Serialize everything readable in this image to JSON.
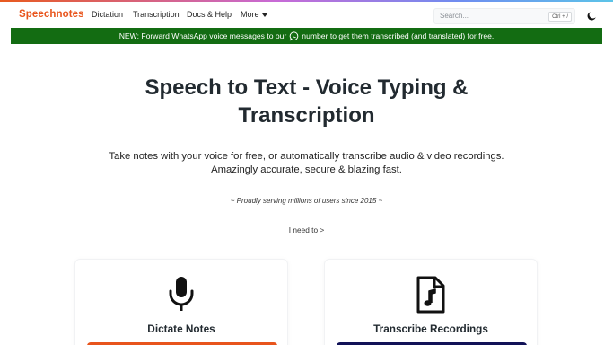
{
  "nav": {
    "brand": "Speechnotes",
    "links": [
      "Dictation",
      "Transcription",
      "Docs & Help",
      "More"
    ],
    "search_placeholder": "Search...",
    "search_shortcut": "Ctrl + /",
    "theme_icon": "moon-icon"
  },
  "banner": {
    "text_before": "NEW: Forward WhatsApp voice messages to our",
    "icon": "whatsapp-icon",
    "text_after": "number to get them transcribed (and translated) for free."
  },
  "hero": {
    "title_line1": "Speech to Text - Voice Typing &",
    "title_line2": "Transcription",
    "subtitle_line1": "Take notes with your voice for free, or automatically transcribe audio & video recordings.",
    "subtitle_line2": "Amazingly accurate, secure & blazing fast.",
    "serving": "~ Proudly serving millions of users since 2015 ~",
    "prompt": "I need to >"
  },
  "cards": [
    {
      "title": "Dictate Notes",
      "icon": "microphone-icon",
      "button_color": "#e8541c"
    },
    {
      "title": "Transcribe Recordings",
      "icon": "audio-file-icon",
      "button_color": "#111257"
    }
  ],
  "colors": {
    "brand": "#e8541c",
    "banner_bg": "#136c12",
    "navy": "#111257"
  }
}
